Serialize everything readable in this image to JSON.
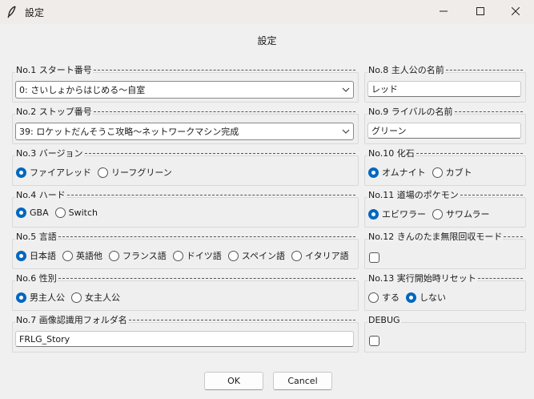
{
  "window": {
    "title": "設定",
    "app_icon": "feather-icon"
  },
  "header": {
    "title": "設定"
  },
  "groups": {
    "no1": {
      "legend": "No.1 スタート番号",
      "value": "0: さいしょからはじめる～自室"
    },
    "no2": {
      "legend": "No.2 ストップ番号",
      "value": "39: ロケットだんそうこ攻略～ネットワークマシン完成"
    },
    "no3": {
      "legend": "No.3 バージョン",
      "options": [
        "ファイアレッド",
        "リーフグリーン"
      ],
      "selected": "ファイアレッド"
    },
    "no4": {
      "legend": "No.4 ハード",
      "options": [
        "GBA",
        "Switch"
      ],
      "selected": "GBA"
    },
    "no5": {
      "legend": "No.5 言語",
      "options": [
        "日本語",
        "英語他",
        "フランス語",
        "ドイツ語",
        "スペイン語",
        "イタリア語"
      ],
      "selected": "日本語"
    },
    "no6": {
      "legend": "No.6 性別",
      "options": [
        "男主人公",
        "女主人公"
      ],
      "selected": "男主人公"
    },
    "no7": {
      "legend": "No.7 画像認識用フォルダ名",
      "value": "FRLG_Story"
    },
    "no8": {
      "legend": "No.8 主人公の名前",
      "value": "レッド"
    },
    "no9": {
      "legend": "No.9 ライバルの名前",
      "value": "グリーン"
    },
    "no10": {
      "legend": "No.10 化石",
      "options": [
        "オムナイト",
        "カブト"
      ],
      "selected": "オムナイト"
    },
    "no11": {
      "legend": "No.11 道場のポケモン",
      "options": [
        "エビワラー",
        "サワムラー"
      ],
      "selected": "エビワラー"
    },
    "no12": {
      "legend": "No.12 きんのたま無限回収モード",
      "checked": false
    },
    "no13": {
      "legend": "No.13 実行開始時リセット",
      "options": [
        "する",
        "しない"
      ],
      "selected": "しない"
    },
    "debug": {
      "legend": "DEBUG",
      "checked": false
    }
  },
  "footer": {
    "ok_label": "OK",
    "cancel_label": "Cancel"
  },
  "colors": {
    "accent": "#0067c0",
    "background": "#f0f0f0",
    "titlebar": "#f0ecea"
  }
}
